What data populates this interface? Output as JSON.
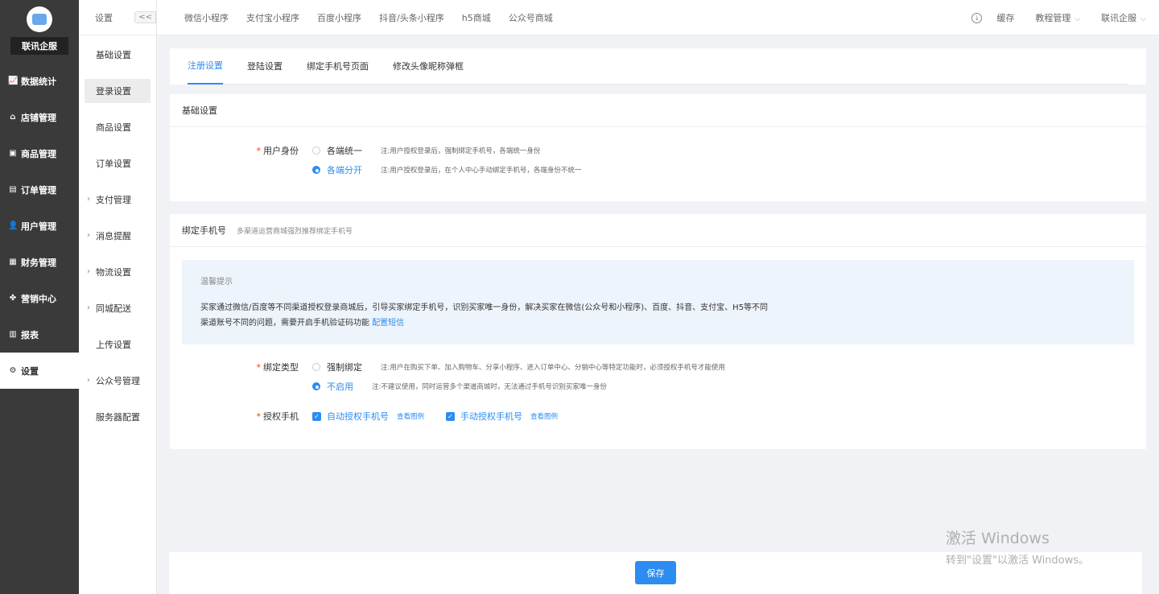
{
  "brand": "联讯企服",
  "main_menu": [
    {
      "icon": "chart-icon",
      "glyph": "📈",
      "label": "数据统计"
    },
    {
      "icon": "shop-icon",
      "glyph": "⌂",
      "label": "店铺管理"
    },
    {
      "icon": "goods-icon",
      "glyph": "▣",
      "label": "商品管理"
    },
    {
      "icon": "order-icon",
      "glyph": "▤",
      "label": "订单管理"
    },
    {
      "icon": "user-icon",
      "glyph": "👤",
      "label": "用户管理"
    },
    {
      "icon": "finance-icon",
      "glyph": "▦",
      "label": "财务管理"
    },
    {
      "icon": "marketing-icon",
      "glyph": "✤",
      "label": "营销中心"
    },
    {
      "icon": "report-icon",
      "glyph": "▥",
      "label": "报表"
    },
    {
      "icon": "settings-icon",
      "glyph": "⚙",
      "label": "设置"
    }
  ],
  "sub_header": {
    "title": "设置",
    "collapse": "<<"
  },
  "sub_menu": [
    {
      "label": "基础设置",
      "arrow": ""
    },
    {
      "label": "登录设置",
      "arrow": ""
    },
    {
      "label": "商品设置",
      "arrow": ""
    },
    {
      "label": "订单设置",
      "arrow": ""
    },
    {
      "label": "支付管理",
      "arrow": "›"
    },
    {
      "label": "消息提醒",
      "arrow": "›"
    },
    {
      "label": "物流设置",
      "arrow": "›"
    },
    {
      "label": "同城配送",
      "arrow": "›"
    },
    {
      "label": "上传设置",
      "arrow": ""
    },
    {
      "label": "公众号管理",
      "arrow": "›"
    },
    {
      "label": "服务器配置",
      "arrow": ""
    }
  ],
  "top_tabs": [
    "微信小程序",
    "支付宝小程序",
    "百度小程序",
    "抖音/头条小程序",
    "h5商城",
    "公众号商城"
  ],
  "top_right": {
    "cache": "缓存",
    "tutorial": "教程管理",
    "account": "联讯企服"
  },
  "content_tabs": [
    "注册设置",
    "登陆设置",
    "绑定手机号页面",
    "修改头像昵称弹框"
  ],
  "basic": {
    "title": "基础设置",
    "identity_label": "用户身份",
    "options": [
      {
        "label": "各端统一",
        "note": "注:用户授权登录后，强制绑定手机号，各端统一身份",
        "selected": false
      },
      {
        "label": "各端分开",
        "note": "注:用户授权登录后，在个人中心手动绑定手机号，各端身份不统一",
        "selected": true
      }
    ]
  },
  "bind": {
    "title": "绑定手机号",
    "subtitle": "多渠道运营商城强烈推荐绑定手机号",
    "tip_title": "温馨提示",
    "tip_line1": "买家通过微信/百度等不同渠道授权登录商城后，引导买家绑定手机号，识别买家唯一身份，解决买家在微信(公众号和小程序)、百度、抖音、支付宝、H5等不同",
    "tip_line2": "渠道账号不同的问题，需要开启手机验证码功能",
    "tip_link": "配置短信",
    "type_label": "绑定类型",
    "type_options": [
      {
        "label": "强制绑定",
        "note": "注:用户在购买下单、加入购物车、分享小程序、进入订单中心、分销中心等特定功能时，必须授权手机号才能使用",
        "selected": false
      },
      {
        "label": "不启用",
        "note": "注:不建议使用，同时运营多个渠道商城时，无法通过手机号识别买家唯一身份",
        "selected": true
      }
    ],
    "auth_label": "授权手机",
    "auth_options": [
      {
        "label": "自动授权手机号",
        "link": "查看图例",
        "checked": true
      },
      {
        "label": "手动授权手机号",
        "link": "查看图例",
        "checked": true
      }
    ]
  },
  "save": "保存",
  "watermark": {
    "line1": "激活 Windows",
    "line2": "转到\"设置\"以激活 Windows。"
  }
}
